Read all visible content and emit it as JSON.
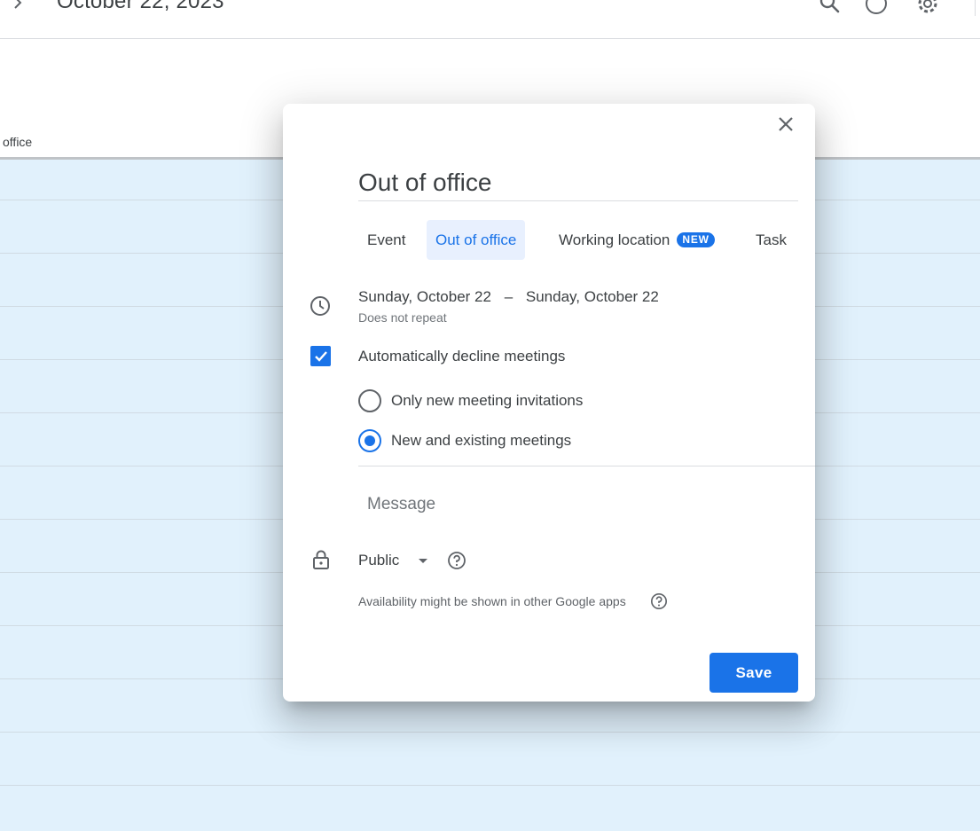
{
  "header": {
    "date_title": "October 22, 2023",
    "icons": [
      "chevron-right-icon",
      "search-icon",
      "help-icon",
      "settings-icon"
    ]
  },
  "calendar": {
    "allday_label": "office",
    "grid_color": "#e1f1fc"
  },
  "dialog": {
    "title": "Out of office",
    "tabs": [
      {
        "label": "Event",
        "active": false
      },
      {
        "label": "Out of office",
        "active": true
      },
      {
        "label": "Working location",
        "active": false,
        "badge": "NEW"
      },
      {
        "label": "Task",
        "active": false
      }
    ],
    "start_date": "Sunday, October 22",
    "date_separator": "–",
    "end_date": "Sunday, October 22",
    "repeat": "Does not repeat",
    "auto_decline": {
      "checked": true,
      "label": "Automatically decline meetings"
    },
    "decline_options": [
      {
        "label": "Only new meeting invitations",
        "selected": false
      },
      {
        "label": "New and existing meetings",
        "selected": true
      }
    ],
    "message_placeholder": "Message",
    "visibility": {
      "value": "Public"
    },
    "availability_note": "Availability might be shown in other Google apps",
    "save_label": "Save"
  },
  "colors": {
    "accent": "#1a73e8",
    "active_tab_bg": "#e8f0fe",
    "text": "#3c4043",
    "muted": "#70757a"
  }
}
